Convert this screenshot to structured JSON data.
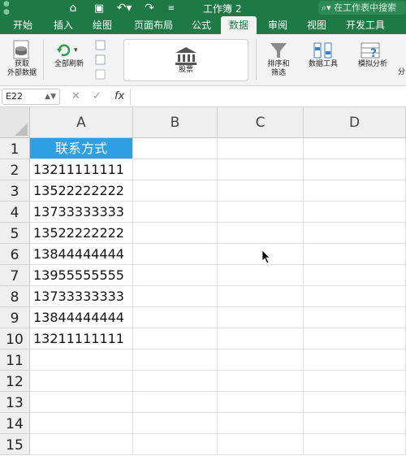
{
  "window": {
    "title": "工作簿 2",
    "search_placeholder": "在工作表中搜索"
  },
  "tabs": [
    {
      "label": "开始",
      "active": false
    },
    {
      "label": "插入",
      "active": false
    },
    {
      "label": "绘图",
      "active": false
    },
    {
      "label": "页面布局",
      "active": false
    },
    {
      "label": "公式",
      "active": false
    },
    {
      "label": "数据",
      "active": true
    },
    {
      "label": "审阅",
      "active": false
    },
    {
      "label": "视图",
      "active": false
    },
    {
      "label": "开发工具",
      "active": false
    }
  ],
  "ribbon": {
    "get_external_data": "获取\n外部数据",
    "refresh_all": "全部刷新",
    "stocks": "股票",
    "sort_filter": "排序和\n筛选",
    "data_tools": "数据工具",
    "what_if": "模拟分析",
    "outline_partial": "分"
  },
  "formula_bar": {
    "name_box": "E22",
    "fx": "fx",
    "formula": ""
  },
  "sheet": {
    "columns": [
      "A",
      "B",
      "C",
      "D"
    ],
    "rows": [
      "1",
      "2",
      "3",
      "4",
      "5",
      "6",
      "7",
      "8",
      "9",
      "10",
      "11",
      "12",
      "13",
      "14",
      "15"
    ],
    "colA": [
      "联系方式",
      "13211111111",
      "13522222222",
      "13733333333",
      "13522222222",
      "13844444444",
      "13955555555",
      "13733333333",
      "13844444444",
      "13211111111",
      "",
      "",
      "",
      "",
      ""
    ]
  },
  "colors": {
    "accent": "#1e7a45",
    "header_fill": "#2d9fe2"
  }
}
